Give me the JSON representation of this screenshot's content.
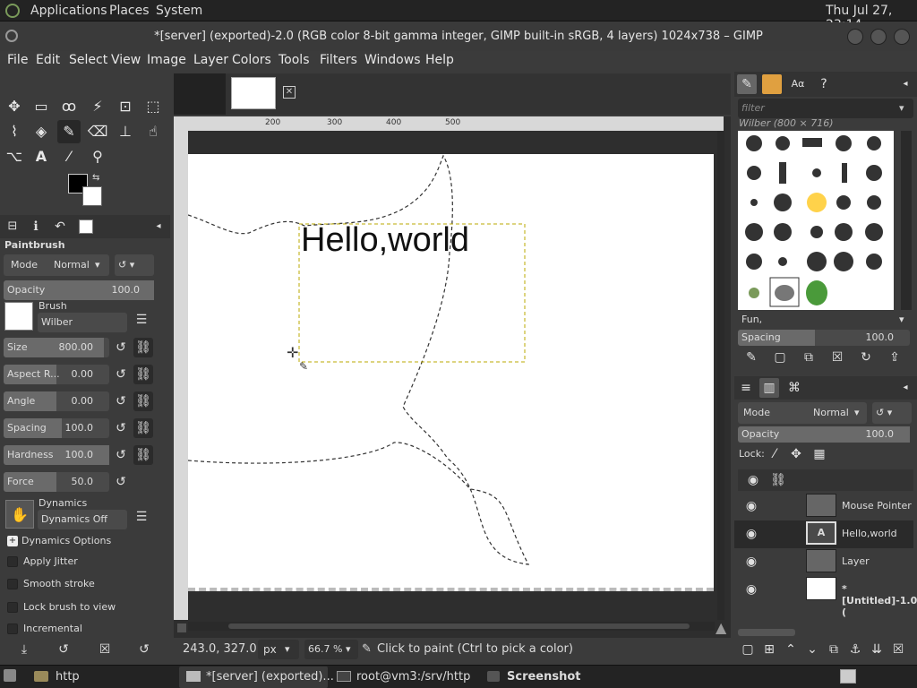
{
  "topbar": {
    "applications": "Applications",
    "places": "Places",
    "system": "System",
    "clock": "Thu Jul 27, 23:14"
  },
  "window": {
    "title": "*[server] (exported)-2.0 (RGB color 8-bit gamma integer, GIMP built-in sRGB, 4 layers) 1024x738 – GIMP"
  },
  "menu": [
    "File",
    "Edit",
    "Select",
    "View",
    "Image",
    "Layer",
    "Colors",
    "Tools",
    "Filters",
    "Windows",
    "Help"
  ],
  "tool_options": {
    "title": "Paintbrush",
    "mode_label": "Mode",
    "mode_value": "Normal",
    "opacity": {
      "label": "Opacity",
      "value": "100.0",
      "fraction": 1.0
    },
    "brush_label": "Brush",
    "brush_value": "Wilber",
    "size": {
      "label": "Size",
      "value": "800.00",
      "fraction": 0.95
    },
    "aspect": {
      "label": "Aspect R...",
      "value": "0.00",
      "fraction": 0.5
    },
    "angle": {
      "label": "Angle",
      "value": "0.00",
      "fraction": 0.5
    },
    "spacing": {
      "label": "Spacing",
      "value": "100.0",
      "fraction": 0.55
    },
    "hardness": {
      "label": "Hardness",
      "value": "100.0",
      "fraction": 1.0
    },
    "force": {
      "label": "Force",
      "value": "50.0",
      "fraction": 0.5
    },
    "dynamics_label": "Dynamics",
    "dynamics_value": "Dynamics Off",
    "dynamics_options": "Dynamics Options",
    "apply_jitter": "Apply Jitter",
    "smooth_stroke": "Smooth stroke",
    "lock_brush": "Lock brush to view",
    "incremental": "Incremental"
  },
  "canvas": {
    "text_layer": "Hello,world",
    "ruler_marks": [
      "200",
      "300",
      "400",
      "500"
    ]
  },
  "statusbar": {
    "coords": "243.0, 327.0",
    "unit": "px",
    "zoom": "66.7 %",
    "message": "Click to paint (Ctrl to pick a color)"
  },
  "brushes": {
    "filter_placeholder": "filter",
    "name": "Wilber (800 × 716)",
    "tag": "Fun,",
    "spacing_label": "Spacing",
    "spacing_value": "100.0",
    "spacing_fraction": 0.45
  },
  "layers": {
    "mode_label": "Mode",
    "mode_value": "Normal",
    "opacity_label": "Opacity",
    "opacity_value": "100.0",
    "lock_label": "Lock:",
    "items": [
      {
        "name": "Mouse Pointer"
      },
      {
        "name": "Hello,world"
      },
      {
        "name": "Layer"
      },
      {
        "name": "*[Untitled]-1.0 ("
      }
    ]
  },
  "taskbar": {
    "http": "http",
    "gimp": "*[server] (exported)...",
    "terminal": "root@vm3:/srv/http",
    "screenshot": "Screenshot"
  }
}
